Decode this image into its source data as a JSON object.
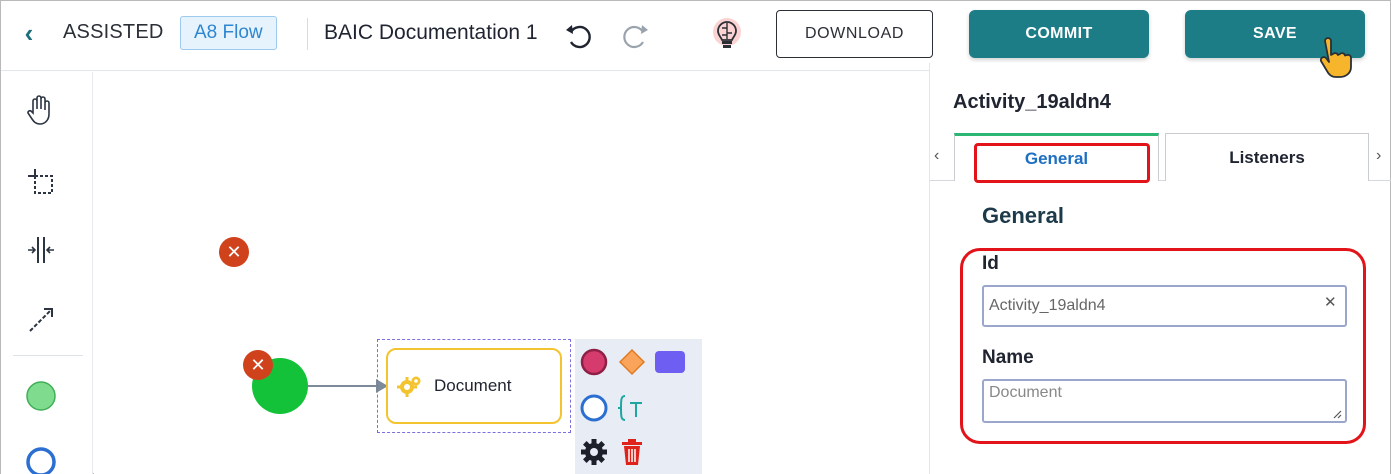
{
  "header": {
    "mode_label": "ASSISTED",
    "flow_badge": "A8 Flow",
    "document_title": "BAIC Documentation 1",
    "download_label": "DOWNLOAD",
    "commit_label": "COMMIT",
    "save_label": "SAVE"
  },
  "palette": {
    "tools": [
      "hand-tool-icon",
      "lasso-tool-icon",
      "space-tool-icon",
      "connect-tool-icon",
      "start-event-icon",
      "end-event-icon"
    ]
  },
  "canvas": {
    "task_label": "Document"
  },
  "panel": {
    "element_id_title": "Activity_19aldn4",
    "tabs": [
      {
        "label": "General",
        "active": true
      },
      {
        "label": "Listeners",
        "active": false
      }
    ],
    "section_title": "General",
    "id_label": "Id",
    "id_value": "Activity_19aldn4",
    "name_label": "Name",
    "name_placeholder": "Document"
  },
  "colors": {
    "primary": "#1c7d86",
    "highlight": "#e3131a",
    "start_event": "#14c23a",
    "task_border": "#f4c430",
    "error": "#d0421c"
  }
}
